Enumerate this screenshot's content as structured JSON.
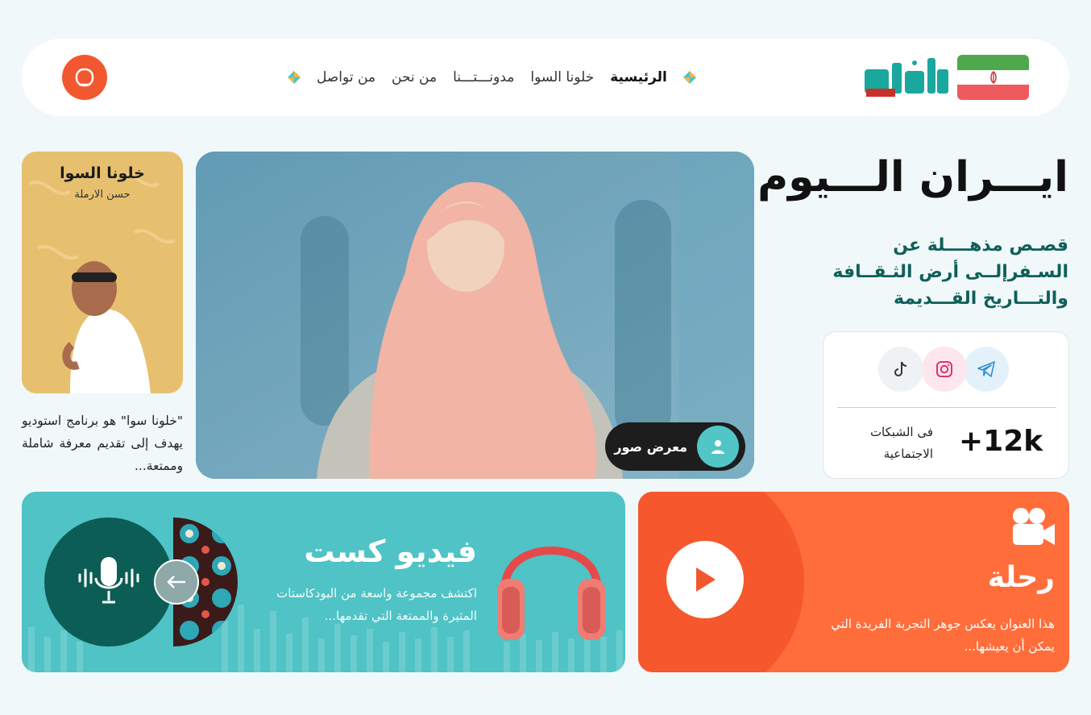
{
  "nav": {
    "items": [
      {
        "label": "الرئيسية",
        "active": true
      },
      {
        "label": "خلونا السوا",
        "active": false
      },
      {
        "label": "مدونـــتـــنا",
        "active": false
      },
      {
        "label": "من نحن",
        "active": false
      },
      {
        "label": "من تواصل",
        "active": false
      }
    ],
    "logo_text": "ايران",
    "search_icon": "search-icon"
  },
  "hero": {
    "title": "ايـــران الـــيوم",
    "subtitle": "قصـص مذهــــلة عن السـفرإلــى أرض الثـقــافة والتـــاريخ القـــديمة"
  },
  "social": {
    "networks": [
      "telegram-icon",
      "instagram-icon",
      "tiktok-icon"
    ],
    "followers": "+12k",
    "followers_label": "فى الشبكات الاجتماعية"
  },
  "gallery": {
    "button_label": "معرض صور"
  },
  "podcast": {
    "title": "خلونا السوا",
    "host": "حسن الارملة",
    "description": "\"خلونا سوا\" هو برنامج استوديو يهدف إلى تقديم معرفة شاملة وممتعة..."
  },
  "videocast": {
    "title": "فيديو كست",
    "description": "اكتشف مجموعة واسعة من البودكاستات المثيرة والممتعة التي تقدمها..."
  },
  "trip": {
    "title": "رحلة",
    "description": "هذا العنوان يعكس جوهر التجربة الفريدة التي يمكن أن يعيشها..."
  },
  "colors": {
    "accent_orange": "#f2582f",
    "teal": "#4fc3c6",
    "dark_teal": "#0c5d55",
    "heading_green": "#0f5f5a",
    "podcast_yellow": "#e7c06f"
  }
}
